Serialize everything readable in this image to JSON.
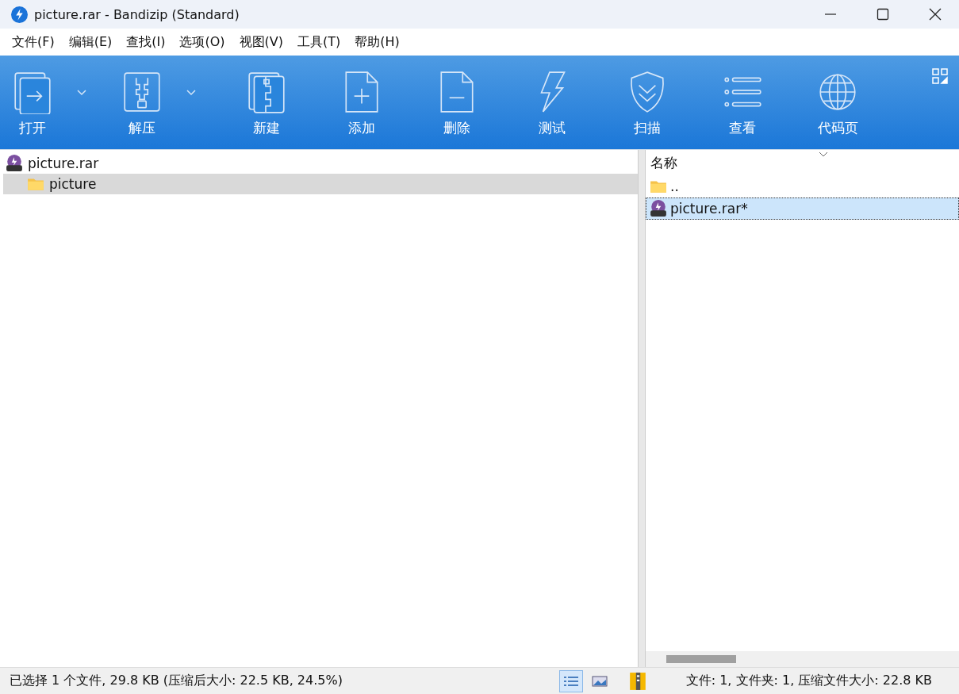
{
  "window": {
    "title": "picture.rar - Bandizip (Standard)"
  },
  "menu": [
    "文件(F)",
    "编辑(E)",
    "查找(I)",
    "选项(O)",
    "视图(V)",
    "工具(T)",
    "帮助(H)"
  ],
  "toolbar": [
    {
      "label": "打开",
      "dropdown": true
    },
    {
      "label": "解压",
      "dropdown": true
    },
    {
      "label": "新建",
      "dropdown": false
    },
    {
      "label": "添加",
      "dropdown": false
    },
    {
      "label": "删除",
      "dropdown": false
    },
    {
      "label": "测试",
      "dropdown": false
    },
    {
      "label": "扫描",
      "dropdown": false
    },
    {
      "label": "查看",
      "dropdown": false
    },
    {
      "label": "代码页",
      "dropdown": false
    }
  ],
  "tree": [
    {
      "name": "picture.rar",
      "kind": "archive",
      "selected": false,
      "children": [
        {
          "name": "picture",
          "kind": "folder",
          "selected": true
        }
      ]
    }
  ],
  "list": {
    "columns": [
      "名称"
    ],
    "rows": [
      {
        "name": "..",
        "kind": "folder",
        "selected": false
      },
      {
        "name": "picture.rar*",
        "kind": "archive",
        "selected": true
      }
    ]
  },
  "status_bar": {
    "left": "已选择 1 个文件, 29.8 KB (压缩后大小: 22.5 KB, 24.5%)",
    "views": [
      {
        "kind": "details",
        "selected": true
      },
      {
        "kind": "thumbnail",
        "selected": false
      }
    ],
    "right": "文件: 1, 文件夹: 1, 压缩文件大小: 22.8 KB"
  }
}
